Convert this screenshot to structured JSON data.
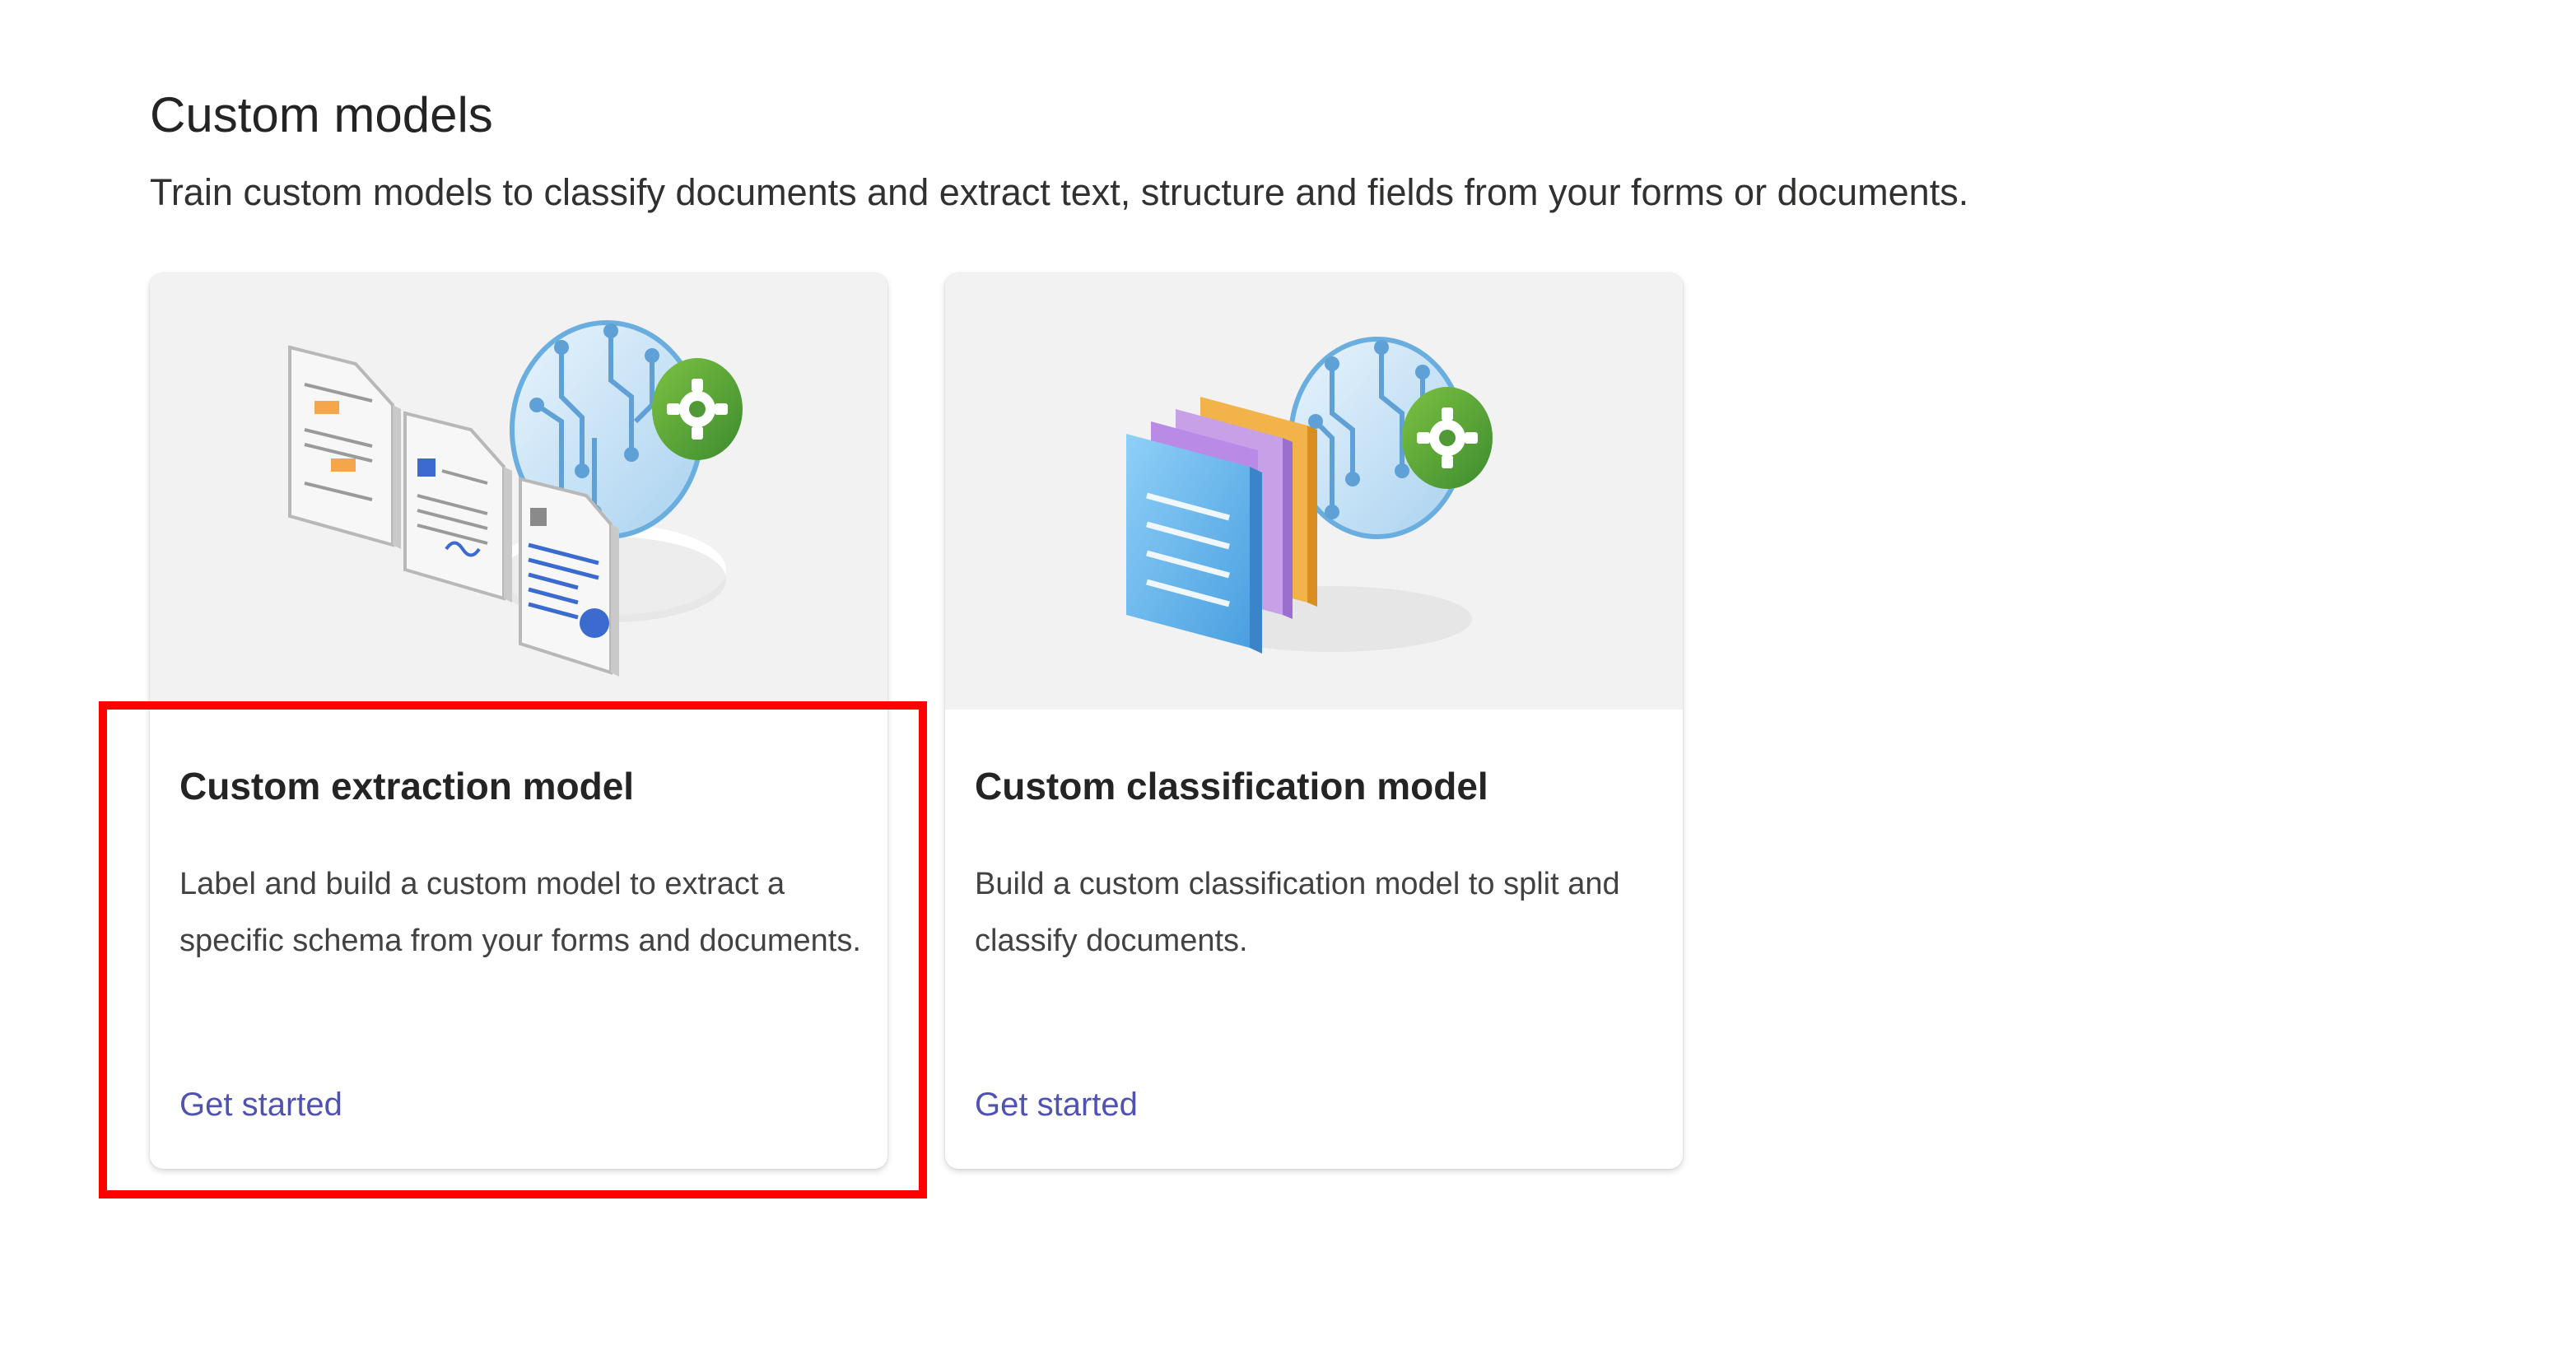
{
  "section": {
    "title": "Custom models",
    "description": "Train custom models to classify documents and extract text, structure and fields from your forms or documents."
  },
  "cards": [
    {
      "title": "Custom extraction model",
      "description": "Label and build a custom model to extract a specific schema from your forms and documents.",
      "link": "Get started",
      "illustration": "documents-with-ai-brain-gear-icon"
    },
    {
      "title": "Custom classification model",
      "description": "Build a custom classification model to split and classify documents.",
      "link": "Get started",
      "illustration": "stacked-documents-with-ai-brain-gear-icon"
    }
  ],
  "colors": {
    "link": "#4f52b2",
    "highlight": "#ff0000",
    "hero_bg": "#f2f2f2"
  }
}
